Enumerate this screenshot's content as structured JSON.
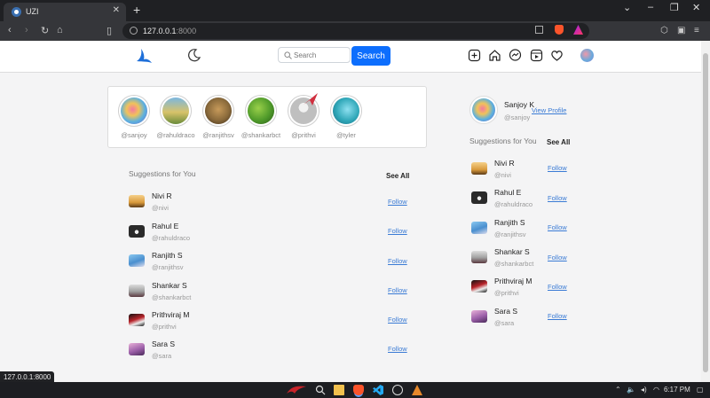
{
  "browser": {
    "tab_title": "UZI",
    "url_host": "127.0.0.1",
    "url_port": ":8000",
    "status_url": "127.0.0.1:8000"
  },
  "navbar": {
    "search_placeholder": "Search",
    "search_button": "Search"
  },
  "stories": [
    {
      "handle": "@sanjoy",
      "color": "#5aa6e0"
    },
    {
      "handle": "@rahuldraco",
      "color": "#c9b24a"
    },
    {
      "handle": "@ranjithsv",
      "color": "#8a6a3b"
    },
    {
      "handle": "@shankarbct",
      "color": "#4f9a2a"
    },
    {
      "handle": "@prithvi",
      "color": "#bfbfbf"
    },
    {
      "handle": "@tyler",
      "color": "#2fa7b8"
    }
  ],
  "main_suggestions": {
    "heading": "Suggestions for You",
    "see_all": "See All",
    "follow_label": "Follow",
    "items": [
      {
        "name": "Nivi R",
        "handle": "@nivi",
        "color": "#d99a3c"
      },
      {
        "name": "Rahul E",
        "handle": "@rahuldraco",
        "color": "#2a2a2a"
      },
      {
        "name": "Ranjith S",
        "handle": "@ranjithsv",
        "color": "#4a8fcf"
      },
      {
        "name": "Shankar S",
        "handle": "@shankarbct",
        "color": "#a0a0a0"
      },
      {
        "name": "Prithviraj M",
        "handle": "@prithvi",
        "color": "#b8232a"
      },
      {
        "name": "Sara S",
        "handle": "@sara",
        "color": "#9b5fa8"
      }
    ]
  },
  "profile": {
    "name": "Sanjoy K",
    "handle": "@sanjoy",
    "view_profile": "View Profile"
  },
  "side_suggestions": {
    "heading": "Suggestions for You",
    "see_all": "See All",
    "follow_label": "Follow",
    "items": [
      {
        "name": "Nivi R",
        "handle": "@nivi",
        "color": "#d99a3c"
      },
      {
        "name": "Rahul E",
        "handle": "@rahuldraco",
        "color": "#2a2a2a"
      },
      {
        "name": "Ranjith S",
        "handle": "@ranjithsv",
        "color": "#4a8fcf"
      },
      {
        "name": "Shankar S",
        "handle": "@shankarbct",
        "color": "#a0a0a0"
      },
      {
        "name": "Prithviraj M",
        "handle": "@prithvi",
        "color": "#b8232a"
      },
      {
        "name": "Sara S",
        "handle": "@sara",
        "color": "#9b5fa8"
      }
    ]
  },
  "taskbar": {
    "time": "6:17 PM"
  },
  "colors": {
    "accent": "#0d6efd",
    "link": "#3a7bd5"
  }
}
